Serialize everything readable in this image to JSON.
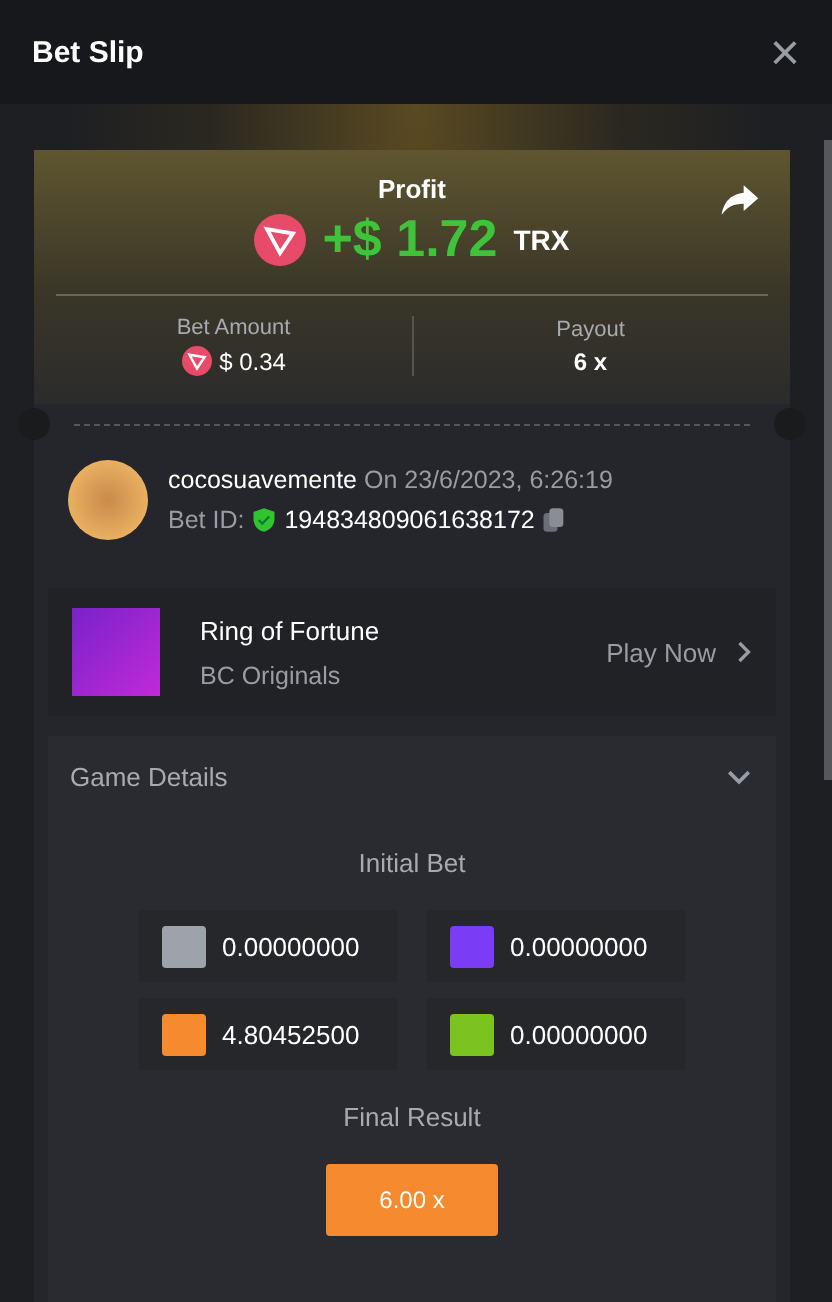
{
  "window": {
    "title": "Bet Slip",
    "close": "×"
  },
  "profit": {
    "label": "Profit",
    "amount": "+$ 1.72",
    "currency": "TRX"
  },
  "bet_amount": {
    "label": "Bet Amount",
    "value": "$ 0.34"
  },
  "payout": {
    "label": "Payout",
    "value": "6 x"
  },
  "player": {
    "name": "cocosuavemente",
    "date": "On 23/6/2023, 6:26:19",
    "bet_id_label": "Bet ID:",
    "bet_id": "194834809061638172",
    "verified": true
  },
  "game": {
    "name": "Ring of Fortune",
    "provider": "BC Originals",
    "action": "Play Now"
  },
  "game_details": {
    "title": "Game Details",
    "expanded": true,
    "initial_bet_label": "Initial Bet",
    "bets": [
      {
        "color": "#9ea3ab",
        "amount": "0.00000000"
      },
      {
        "color": "#7a3cf5",
        "amount": "0.00000000"
      },
      {
        "color": "#f58a2e",
        "amount": "4.80452500"
      },
      {
        "color": "#7ac321",
        "amount": "0.00000000"
      }
    ],
    "final_result_label": "Final Result",
    "final_result": {
      "value": "6.00 x",
      "color": "#f58a2e"
    }
  }
}
